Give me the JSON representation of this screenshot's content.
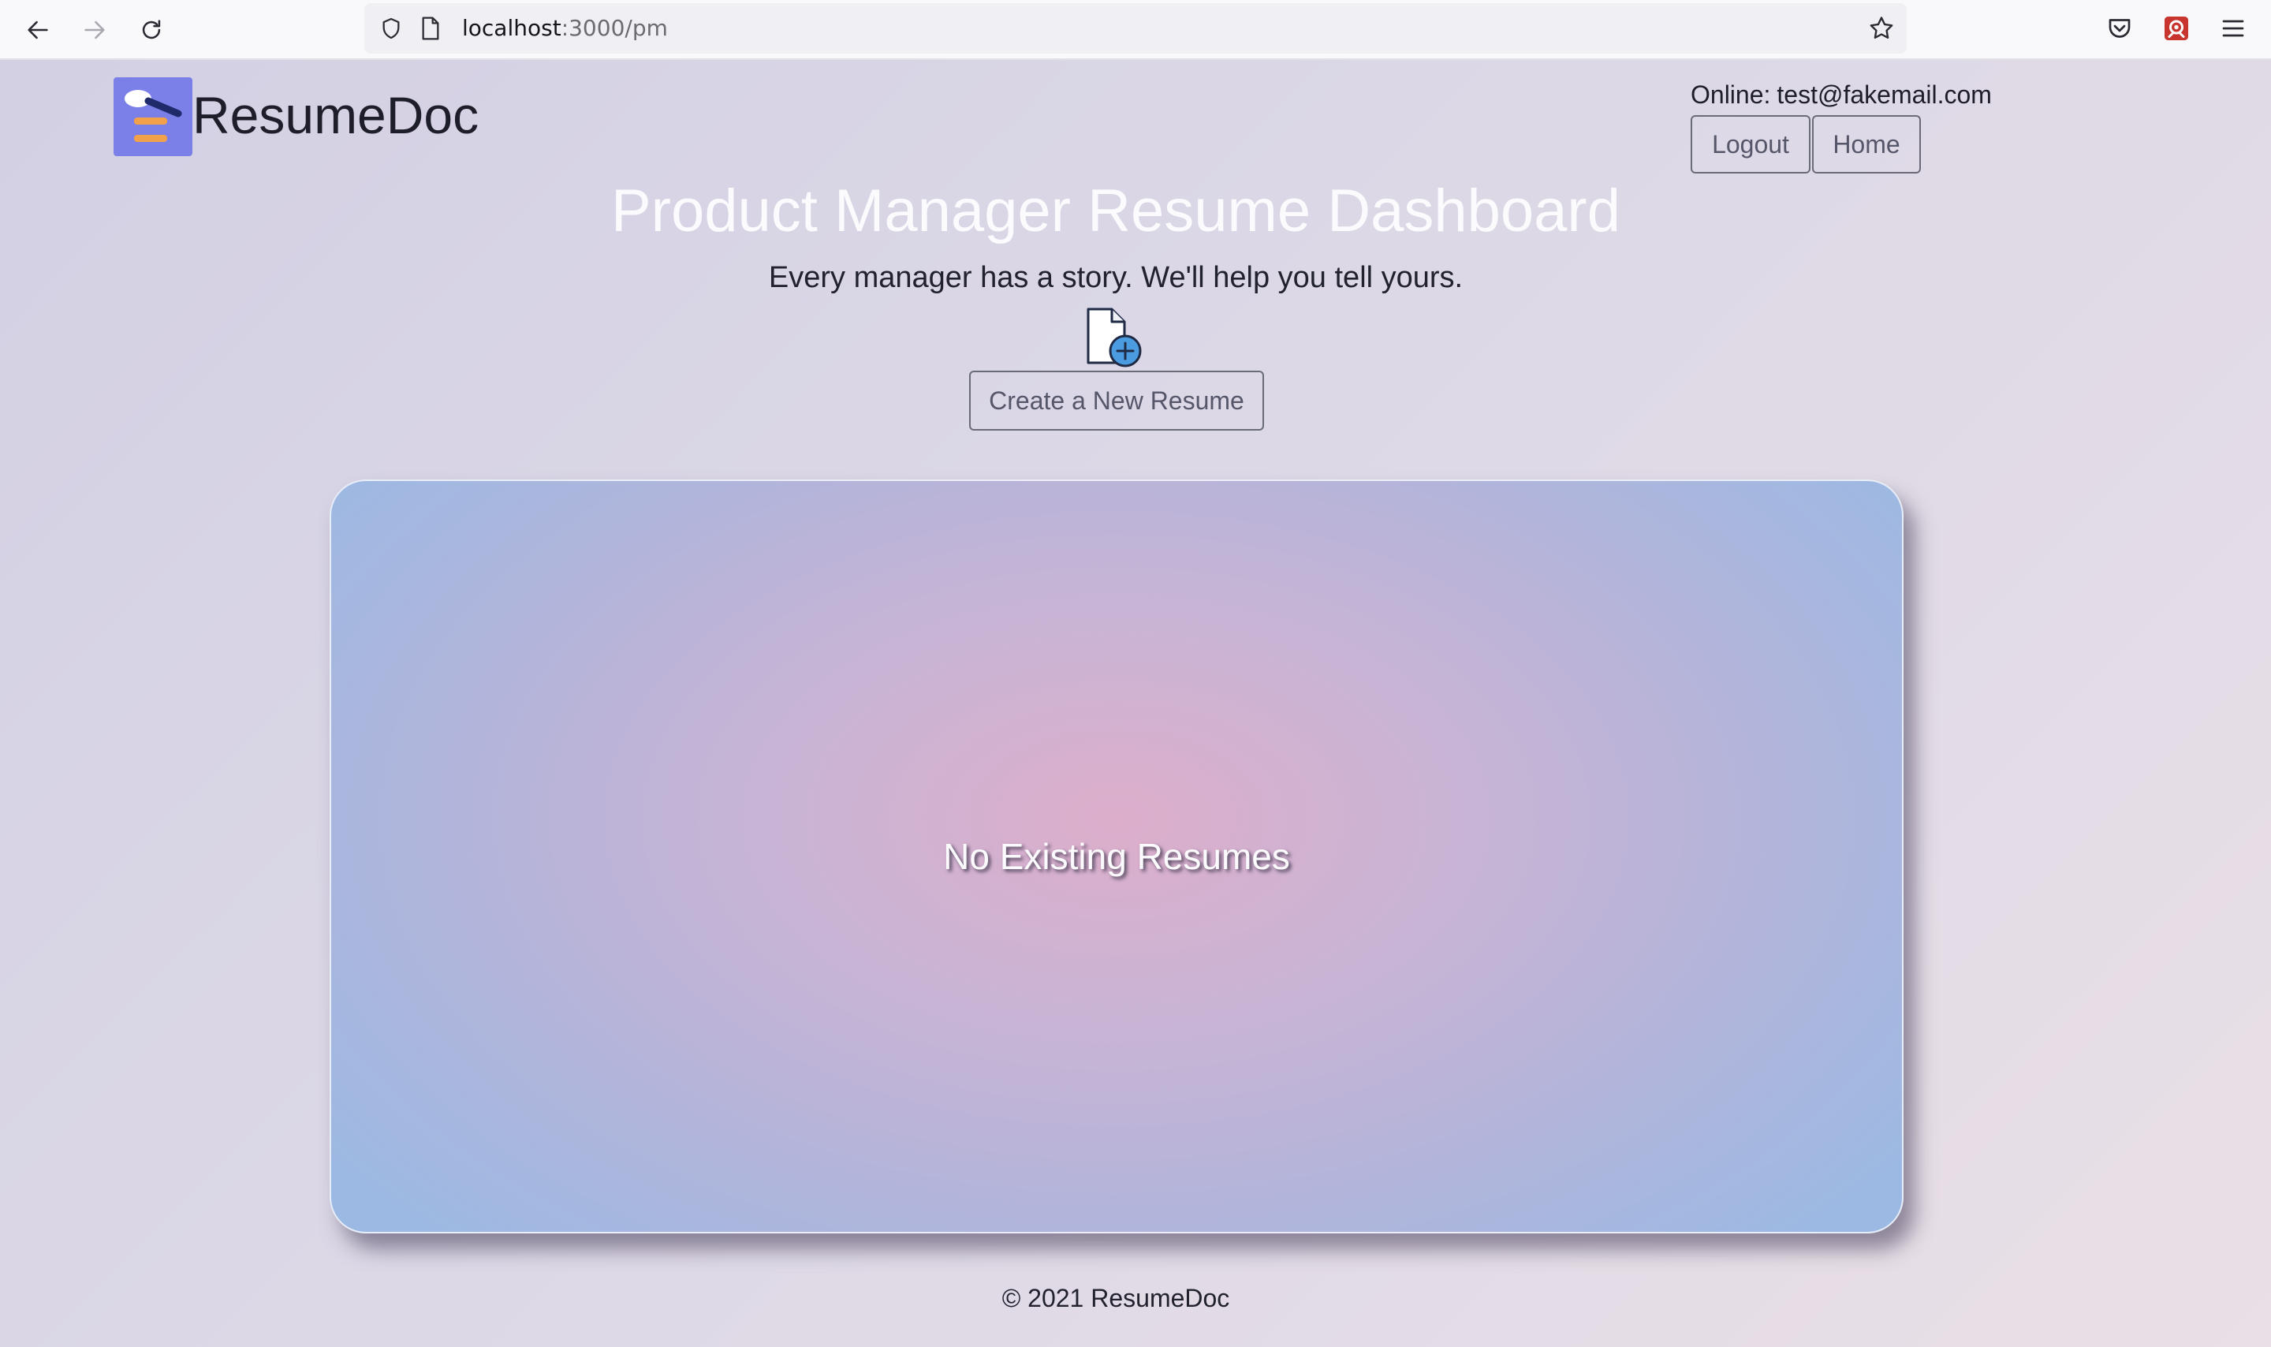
{
  "browser": {
    "url_host": "localhost",
    "url_path": ":3000/pm"
  },
  "header": {
    "brand": "ResumeDoc",
    "online_label": "Online:",
    "online_email": "test@fakemail.com",
    "logout_label": "Logout",
    "home_label": "Home"
  },
  "hero": {
    "title": "Product Manager Resume Dashboard",
    "tagline": "Every manager has a story. We'll help you tell yours.",
    "create_label": "Create a New Resume"
  },
  "resumes": {
    "empty_message": "No Existing Resumes"
  },
  "footer": {
    "text": "© 2021 ResumeDoc"
  },
  "colors": {
    "logo_bg": "#7b7fe8",
    "logo_accent": "#f0a14a",
    "logo_pen": "#1f2a6b",
    "add_badge": "#4a9be0"
  },
  "icons": [
    "back-arrow-icon",
    "forward-arrow-icon",
    "reload-icon",
    "shield-icon",
    "page-icon",
    "bookmark-star-icon",
    "pocket-icon",
    "extension-icon",
    "menu-icon",
    "logo-icon",
    "new-document-icon"
  ]
}
